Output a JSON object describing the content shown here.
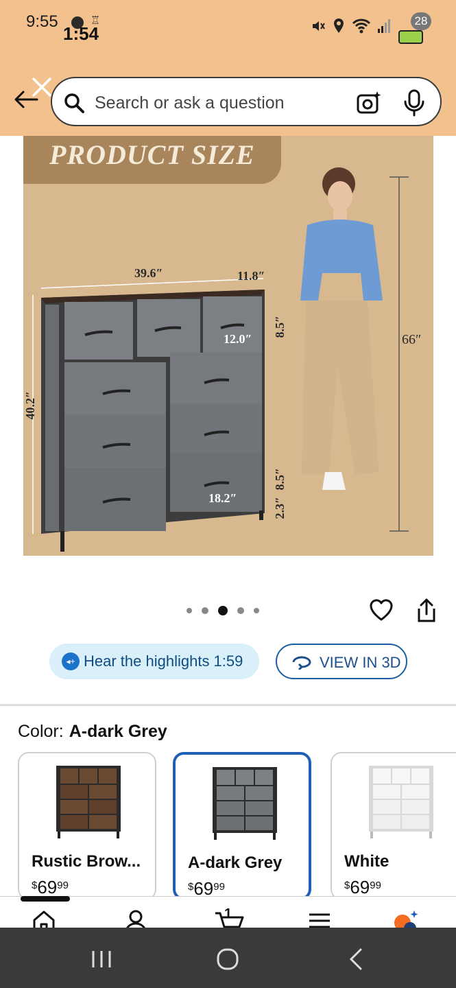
{
  "status_bar": {
    "time": "9:55",
    "overlay_time": "1:54",
    "battery_level": "28"
  },
  "header": {
    "search_placeholder": "Search or ask a question"
  },
  "product_image": {
    "banner": "PRODUCT SIZE",
    "dimensions": {
      "width": "39.6″",
      "depth": "11.8″",
      "height": "40.2″",
      "drawer_small_width": "12.0″",
      "drawer_small_height": "8.5″",
      "drawer_large_width": "18.2″",
      "drawer_large_height": "8.5″",
      "leg_height": "2.3″",
      "person_height": "66″"
    },
    "carousel": {
      "total": 5,
      "active_index": 2
    }
  },
  "actions": {
    "hear_label": "Hear the highlights 1:59",
    "view3d_label": "VIEW IN 3D"
  },
  "color_selector": {
    "label": "Color:",
    "selected": "A-dark Grey",
    "options": [
      {
        "name": "Rustic Brow...",
        "price_whole": "69",
        "price_fraction": "99",
        "currency": "$",
        "color": "#5a3c28"
      },
      {
        "name": "A-dark Grey",
        "price_whole": "69",
        "price_fraction": "99",
        "currency": "$",
        "color": "#6b6e72"
      },
      {
        "name": "White",
        "price_whole": "69",
        "price_fraction": "99",
        "currency": "$",
        "color": "#f2f2f2"
      }
    ]
  },
  "bottom_nav": {
    "cart_count": "1",
    "items": [
      "home-icon",
      "profile-icon",
      "cart-icon",
      "menu-icon",
      "ai-assistant-icon"
    ]
  },
  "colors": {
    "header_bg": "#f3c18e",
    "accent_blue": "#1f5fb5",
    "image_bg": "#d7b88f"
  }
}
